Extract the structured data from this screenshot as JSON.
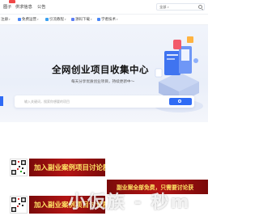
{
  "topnav": {
    "links": [
      "圈子",
      "供求信息",
      "公告"
    ],
    "search_scope": "全部"
  },
  "categories": [
    {
      "label": "注册"
    },
    {
      "label": "免费运营"
    },
    {
      "label": "引流教程"
    },
    {
      "label": "源码下载"
    },
    {
      "label": "学者技术"
    }
  ],
  "hero": {
    "title": "全网创业项目收集中心",
    "subtitle": "每天分享优质创业项目，持续更新中～",
    "search_placeholder": "输入关键词，搜索你想要的项目"
  },
  "promo": {
    "banner1": "加入副业案例项目讨论群",
    "banner2_left": "副业案全部免费，只需要讨论获",
    "banner3": "加入副业案例项目讨论群"
  },
  "watermark": "小仮族 - 秒m",
  "colors": {
    "accent": "#2f6bf5",
    "banner_red": "#a61111",
    "banner_text": "#ffe466"
  }
}
